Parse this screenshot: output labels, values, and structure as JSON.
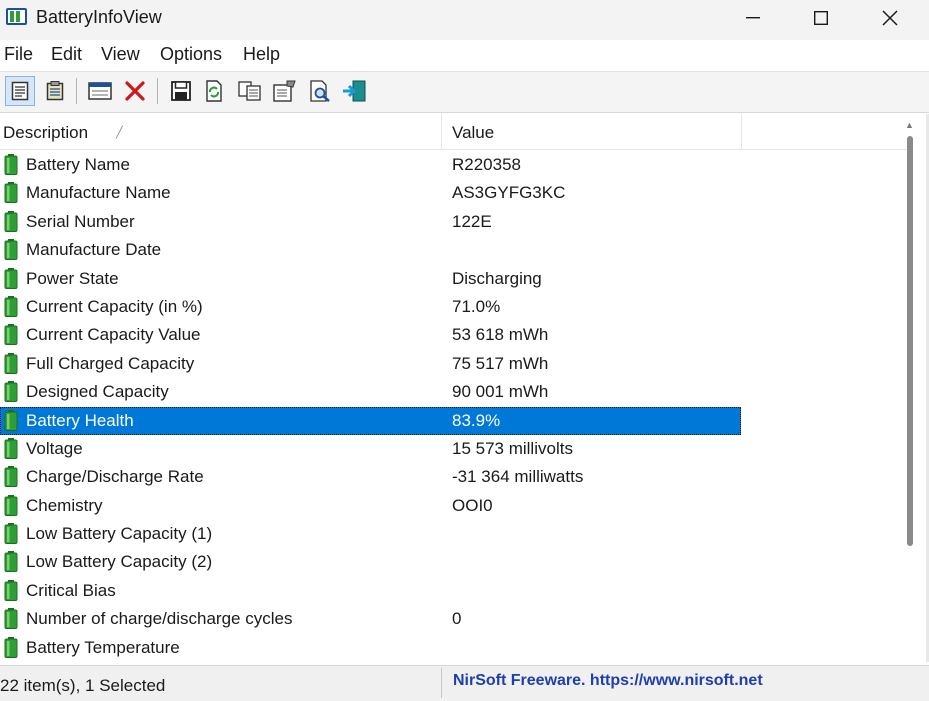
{
  "window": {
    "title": "BatteryInfoView"
  },
  "menu": {
    "items": [
      "File",
      "Edit",
      "View",
      "Options",
      "Help"
    ]
  },
  "toolbar": {
    "icons": [
      "html-report-selected-icon",
      "html-report-all-icon",
      "properties-window-icon",
      "delete-icon",
      "save-icon",
      "refresh-icon",
      "copy-icon",
      "properties-icon",
      "find-icon",
      "exit-icon"
    ]
  },
  "list": {
    "columns": [
      "Description",
      "Value"
    ],
    "rows": [
      {
        "description": "Battery Name",
        "value": "R220358"
      },
      {
        "description": "Manufacture Name",
        "value": "AS3GYFG3KC"
      },
      {
        "description": "Serial Number",
        "value": "122E"
      },
      {
        "description": "Manufacture Date",
        "value": ""
      },
      {
        "description": "Power State",
        "value": "Discharging"
      },
      {
        "description": "Current Capacity (in %)",
        "value": "71.0%"
      },
      {
        "description": "Current Capacity Value",
        "value": "53 618 mWh"
      },
      {
        "description": "Full Charged Capacity",
        "value": "75 517 mWh"
      },
      {
        "description": "Designed Capacity",
        "value": "90 001 mWh"
      },
      {
        "description": "Battery Health",
        "value": "83.9%",
        "selected": true
      },
      {
        "description": "Voltage",
        "value": "15 573 millivolts"
      },
      {
        "description": "Charge/Discharge Rate",
        "value": "-31 364 milliwatts"
      },
      {
        "description": "Chemistry",
        "value": "OOI0"
      },
      {
        "description": "Low Battery Capacity (1)",
        "value": ""
      },
      {
        "description": "Low Battery Capacity (2)",
        "value": ""
      },
      {
        "description": "Critical Bias",
        "value": ""
      },
      {
        "description": "Number of charge/discharge cycles",
        "value": "0"
      },
      {
        "description": "Battery Temperature",
        "value": ""
      }
    ]
  },
  "status": {
    "items": "22 item(s), 1 Selected",
    "link": "NirSoft Freeware. https://www.nirsoft.net"
  },
  "colors": {
    "selection": "#0078d7",
    "battery_green": "#2e9e36",
    "link": "#1f3fae"
  }
}
